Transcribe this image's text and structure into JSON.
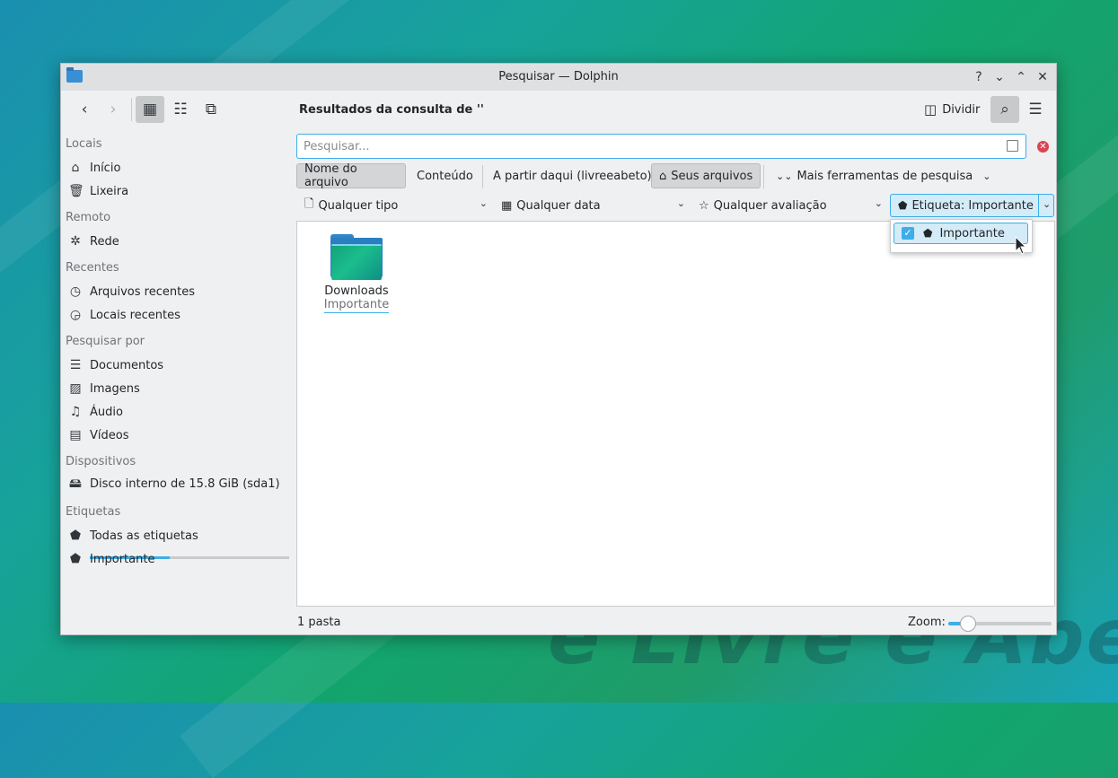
{
  "window": {
    "title": "Pesquisar — Dolphin",
    "controls": [
      "?",
      "⌄",
      "⌃",
      "✕"
    ]
  },
  "toolbar": {
    "breadcrumb": "Resultados da consulta de ''",
    "split_label": "Dividir"
  },
  "sidebar": {
    "sections": [
      {
        "title": "Locais",
        "items": [
          {
            "label": "Início",
            "icon": "home-icon"
          },
          {
            "label": "Lixeira",
            "icon": "trash-icon"
          }
        ]
      },
      {
        "title": "Remoto",
        "items": [
          {
            "label": "Rede",
            "icon": "network-icon"
          }
        ]
      },
      {
        "title": "Recentes",
        "items": [
          {
            "label": "Arquivos recentes",
            "icon": "recent-files-icon"
          },
          {
            "label": "Locais recentes",
            "icon": "recent-places-icon"
          }
        ]
      },
      {
        "title": "Pesquisar por",
        "items": [
          {
            "label": "Documentos",
            "icon": "document-icon"
          },
          {
            "label": "Imagens",
            "icon": "image-icon"
          },
          {
            "label": "Áudio",
            "icon": "music-icon"
          },
          {
            "label": "Vídeos",
            "icon": "video-icon"
          }
        ]
      },
      {
        "title": "Dispositivos",
        "items": [
          {
            "label": "Disco interno de 15.8 GiB (sda1)",
            "icon": "drive-icon",
            "usage": 0.4
          }
        ]
      },
      {
        "title": "Etiquetas",
        "items": [
          {
            "label": "Todas as etiquetas",
            "icon": "tags-icon"
          },
          {
            "label": "Importante",
            "icon": "tag-icon"
          }
        ]
      }
    ]
  },
  "search": {
    "placeholder": "Pesquisar...",
    "value": ""
  },
  "filters": {
    "filename": "Nome do arquivo",
    "content": "Conteúdo",
    "from_here": "A partir daqui (livreeabeto)",
    "your_files": "Seus arquivos",
    "more_tools": "Mais ferramentas de pesquisa"
  },
  "facets": {
    "type": "Qualquer tipo",
    "date": "Qualquer data",
    "rating": "Qualquer avaliação",
    "tag": "Etiqueta: Importante"
  },
  "tag_popup": {
    "item": "Importante",
    "checked": true
  },
  "results": [
    {
      "name": "Downloads",
      "tag": "Importante"
    }
  ],
  "status": {
    "count": "1 pasta",
    "zoom_label": "Zoom:",
    "zoom_level": 0.18
  },
  "colors": {
    "accent": "#3daee9",
    "window_bg": "#eff0f1"
  },
  "wallpaper_text": "e Livre e Aberto"
}
